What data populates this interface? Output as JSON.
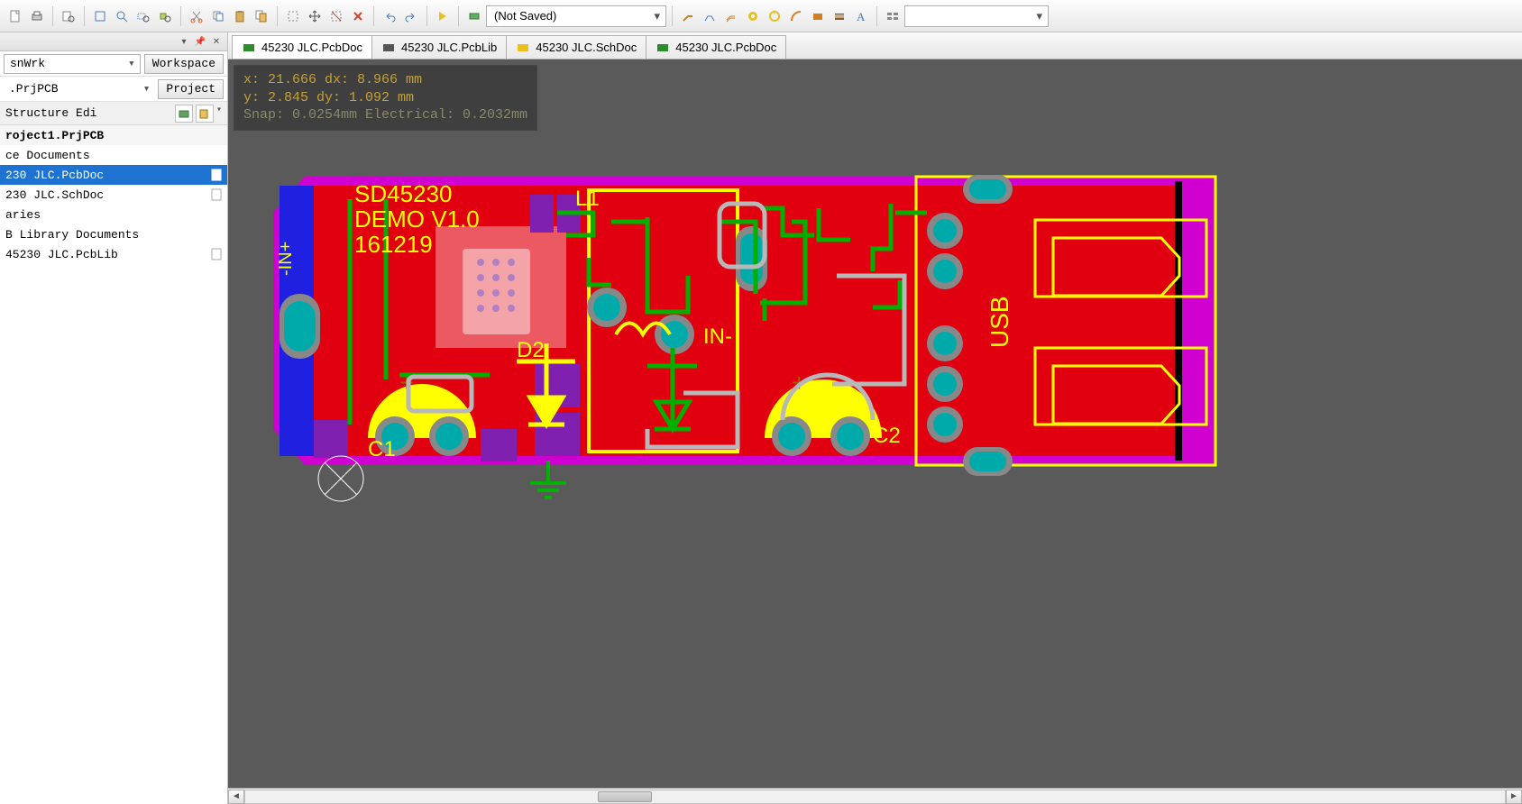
{
  "toolbar": {
    "combo_state": "(Not Saved)"
  },
  "sidebar": {
    "workspace_combo": "snWrk",
    "workspace_btn": "Workspace",
    "project_combo": ".PrjPCB",
    "project_btn": "Project",
    "structure_label": "Structure Edi"
  },
  "tree": {
    "root": "roject1.PrjPCB",
    "items": [
      {
        "label": "ce Documents",
        "icon": false,
        "selected": false
      },
      {
        "label": "230 JLC.PcbDoc",
        "icon": true,
        "selected": true
      },
      {
        "label": "230 JLC.SchDoc",
        "icon": true,
        "selected": false
      },
      {
        "label": "aries",
        "icon": false,
        "selected": false
      },
      {
        "label": "B Library Documents",
        "icon": false,
        "selected": false
      },
      {
        "label": "45230 JLC.PcbLib",
        "icon": true,
        "selected": false
      }
    ]
  },
  "tabs": [
    {
      "label": "45230 JLC.PcbDoc",
      "color": "#2e8b2e"
    },
    {
      "label": "45230 JLC.PcbLib",
      "color": "#555"
    },
    {
      "label": "45230 JLC.SchDoc",
      "color": "#c49a1a"
    },
    {
      "label": "45230 JLC.PcbDoc",
      "color": "#2e8b2e"
    }
  ],
  "coords": {
    "line1": "x: 21.666   dx:  8.966  mm",
    "line2": "y: 2.845    dy:  1.092  mm",
    "line3": "Snap: 0.0254mm Electrical: 0.2032mm"
  },
  "pcb": {
    "silkscreen": {
      "title": "SD45230",
      "subtitle": "DEMO  V1.0",
      "date": "161219",
      "refs": {
        "l1": "L1",
        "d2": "D2",
        "c1": "C1",
        "c2": "C2",
        "inm": "IN-",
        "usb": "USB",
        "inp": "-IN+"
      }
    }
  }
}
